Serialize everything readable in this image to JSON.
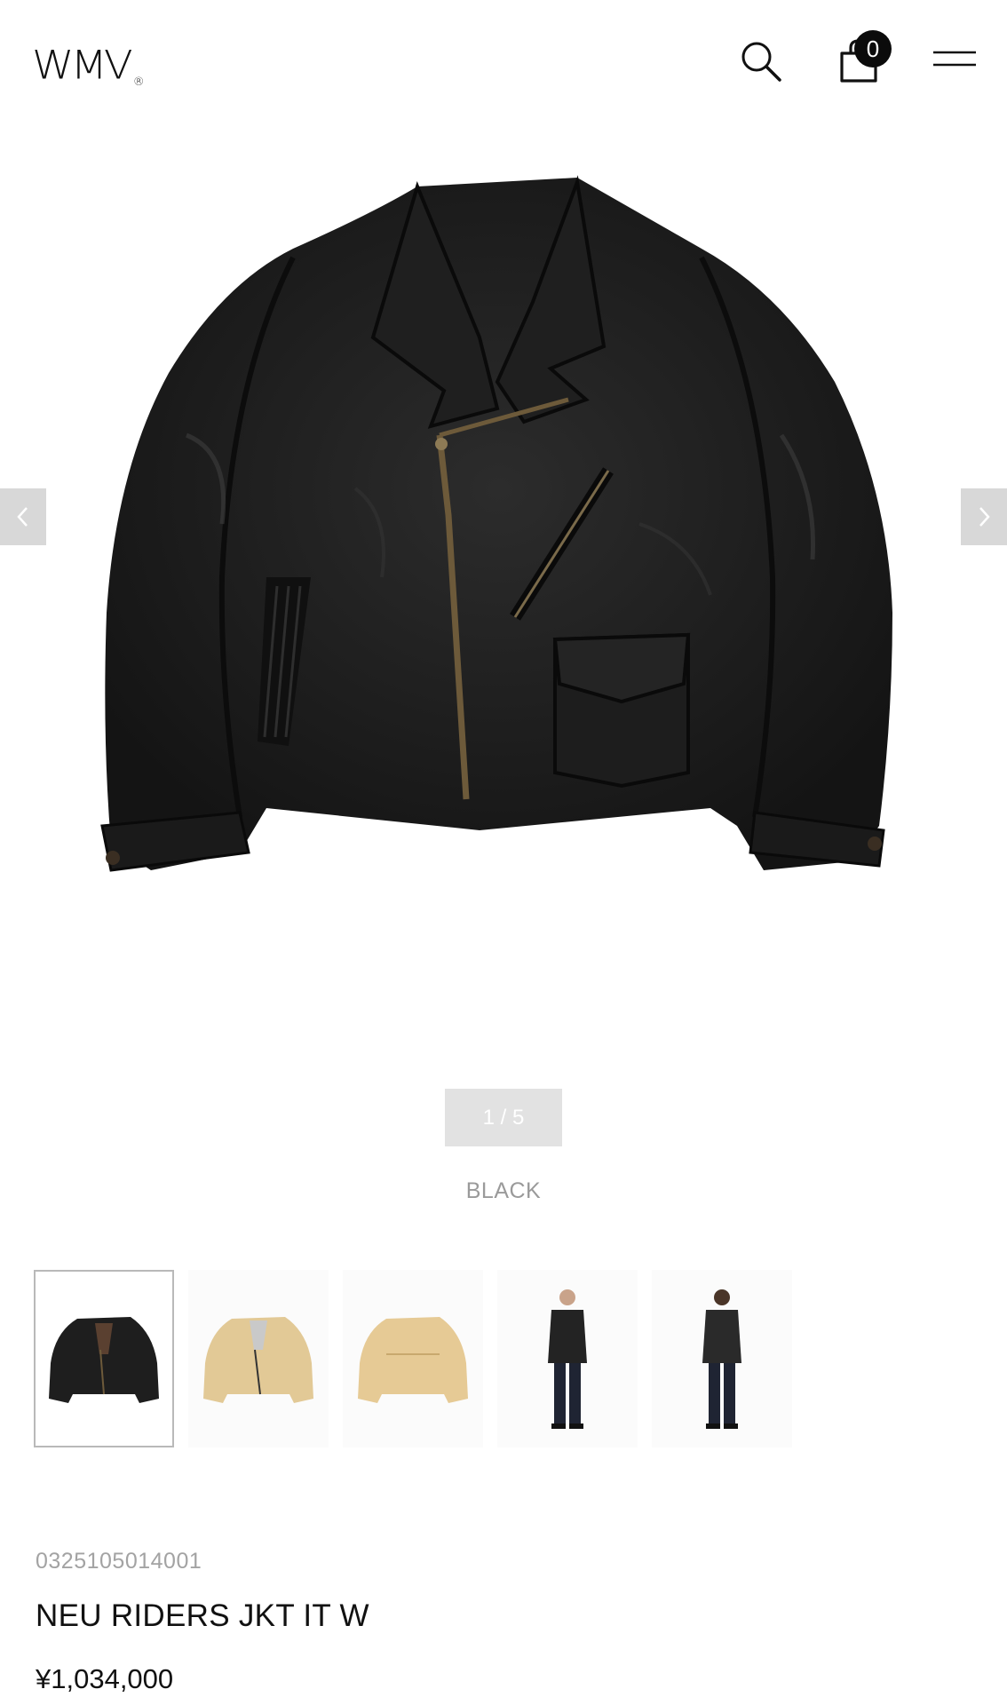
{
  "header": {
    "logo": "WMV",
    "logo_mark": "®",
    "cart_count": "0"
  },
  "icons": {
    "search": "search-icon",
    "cart": "shopping-bag-icon",
    "menu": "hamburger-menu-icon",
    "prev": "chevron-left-icon",
    "next": "chevron-right-icon"
  },
  "gallery": {
    "pager": "1 / 5",
    "color": "BLACK",
    "thumbnails": [
      {
        "label": "black-jacket-front",
        "active": true
      },
      {
        "label": "tan-jacket-front",
        "active": false
      },
      {
        "label": "tan-jacket-back",
        "active": false
      },
      {
        "label": "model-front",
        "active": false
      },
      {
        "label": "model-back",
        "active": false
      }
    ]
  },
  "product": {
    "sku": "0325105014001",
    "name": "NEU RIDERS JKT IT W",
    "price": "¥1,034,000"
  },
  "colors": {
    "leather_black": "#1c1c1c",
    "leather_tan": "#e2c996",
    "accent_black": "#0b0b0b",
    "arrow_bg": "#d8d8d8",
    "pager_bg": "#e2e2e2"
  }
}
